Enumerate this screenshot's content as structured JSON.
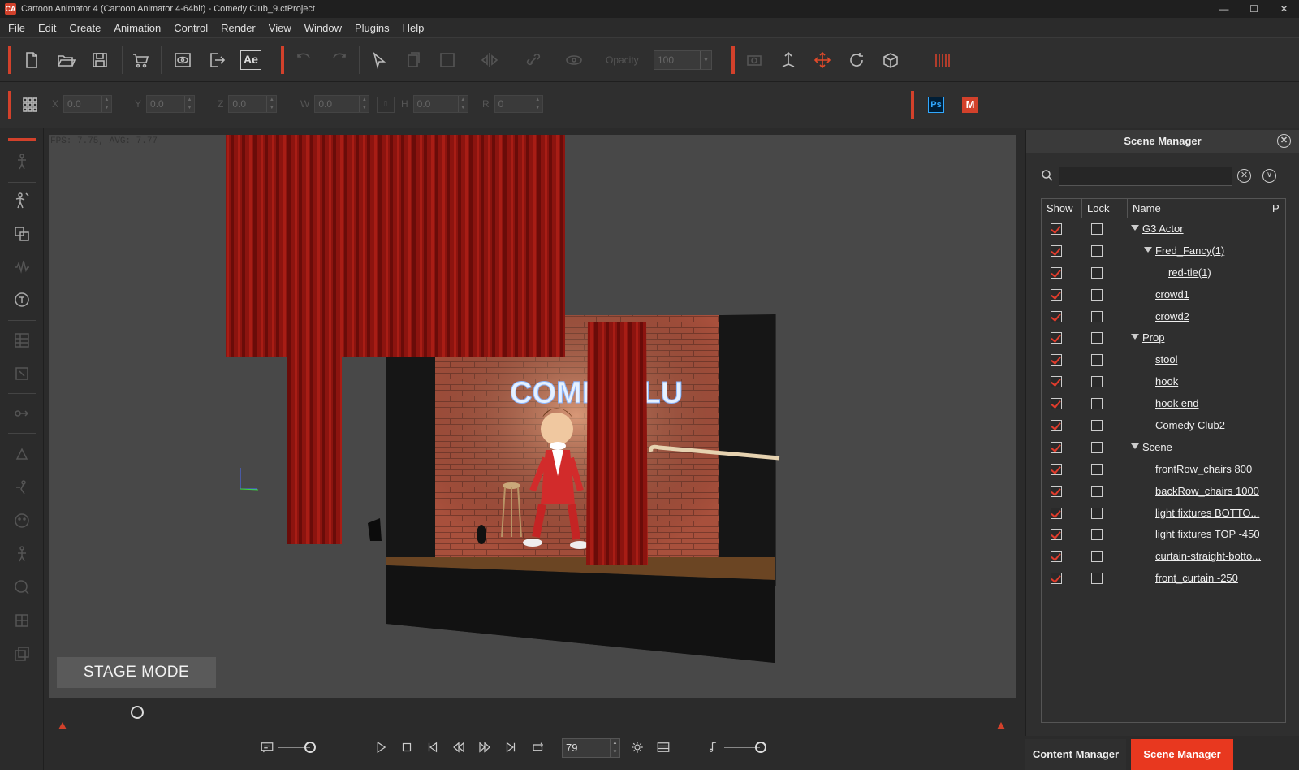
{
  "window": {
    "title": "Cartoon Animator 4  (Cartoon Animator 4-64bit) - Comedy Club_9.ctProject",
    "app_icon_glyph": "CA"
  },
  "menu": [
    "File",
    "Edit",
    "Create",
    "Animation",
    "Control",
    "Render",
    "View",
    "Window",
    "Plugins",
    "Help"
  ],
  "toolbar": {
    "ae_label": "Ae",
    "opacity_label": "Opacity",
    "opacity_value": "100",
    "ps_label": "Ps",
    "m_label": "M"
  },
  "transform": [
    {
      "label": "X",
      "value": "0.0"
    },
    {
      "label": "Y",
      "value": "0.0"
    },
    {
      "label": "Z",
      "value": "0.0"
    },
    {
      "label": "W",
      "value": "0.0"
    },
    {
      "label": "H",
      "value": "0.0"
    },
    {
      "label": "R",
      "value": "0"
    }
  ],
  "viewport": {
    "fps_text": "FPS: 7.75, AVG: 7.77",
    "mode_button": "STAGE MODE",
    "sign_text": "COMEI CLU"
  },
  "playback": {
    "frame": "79",
    "timeline_progress": 0.08
  },
  "scene_manager": {
    "title": "Scene Manager",
    "search_placeholder": "",
    "columns": [
      "Show",
      "Lock",
      "Name",
      "P"
    ],
    "items": [
      {
        "name": "G3 Actor",
        "level": 0,
        "expandable": true,
        "show": true,
        "lock": false
      },
      {
        "name": "Fred_Fancy(1)",
        "level": 1,
        "expandable": true,
        "show": true,
        "lock": false
      },
      {
        "name": "red-tie(1)",
        "level": 2,
        "expandable": false,
        "show": true,
        "lock": false
      },
      {
        "name": "crowd1",
        "level": 1,
        "expandable": false,
        "show": true,
        "lock": false
      },
      {
        "name": "crowd2",
        "level": 1,
        "expandable": false,
        "show": true,
        "lock": false
      },
      {
        "name": "Prop",
        "level": 0,
        "expandable": true,
        "show": true,
        "lock": false
      },
      {
        "name": "stool",
        "level": 1,
        "expandable": false,
        "show": true,
        "lock": false
      },
      {
        "name": "hook",
        "level": 1,
        "expandable": false,
        "show": true,
        "lock": false
      },
      {
        "name": "hook end",
        "level": 1,
        "expandable": false,
        "show": true,
        "lock": false
      },
      {
        "name": "Comedy Club2",
        "level": 1,
        "expandable": false,
        "show": true,
        "lock": false
      },
      {
        "name": "Scene",
        "level": 0,
        "expandable": true,
        "show": true,
        "lock": false
      },
      {
        "name": "frontRow_chairs 800",
        "level": 1,
        "expandable": false,
        "show": true,
        "lock": false
      },
      {
        "name": "backRow_chairs 1000",
        "level": 1,
        "expandable": false,
        "show": true,
        "lock": false
      },
      {
        "name": "light fixtures BOTTO...",
        "level": 1,
        "expandable": false,
        "show": true,
        "lock": false
      },
      {
        "name": "light fixtures TOP -450",
        "level": 1,
        "expandable": false,
        "show": true,
        "lock": false
      },
      {
        "name": "curtain-straight-botto...",
        "level": 1,
        "expandable": false,
        "show": true,
        "lock": false
      },
      {
        "name": "front_curtain -250",
        "level": 1,
        "expandable": false,
        "show": true,
        "lock": false
      }
    ]
  },
  "tabs": [
    {
      "label": "Content Manager",
      "active": false
    },
    {
      "label": "Scene Manager",
      "active": true
    }
  ],
  "colors": {
    "accent": "#d2412b",
    "check": "#e03c2c",
    "curtain": "#8c140f",
    "panel": "#2f2f2f"
  }
}
